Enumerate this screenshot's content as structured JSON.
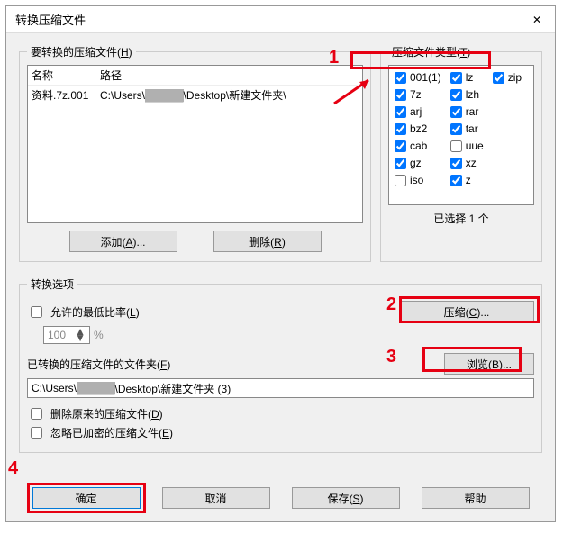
{
  "window": {
    "title": "转换压缩文件"
  },
  "source": {
    "group_label": "要转换的压缩文件(",
    "group_hotkey": "H",
    "group_label_end": ")",
    "col_name": "名称",
    "col_path": "路径",
    "rows": [
      {
        "name": "资料.7z.001",
        "path_pre": "C:\\Users\\",
        "path_mask": "█████",
        "path_post": "\\Desktop\\新建文件夹\\"
      }
    ],
    "add_btn": "添加(",
    "add_hotkey": "A",
    "add_end": ")...",
    "remove_btn": "删除(",
    "remove_hotkey": "R",
    "remove_end": ")"
  },
  "types": {
    "group_label": "压缩文件类型(",
    "group_hotkey": "T",
    "group_end": ")",
    "items": [
      {
        "label": "001(1)",
        "checked": true
      },
      {
        "label": "7z",
        "checked": true
      },
      {
        "label": "arj",
        "checked": true
      },
      {
        "label": "bz2",
        "checked": true
      },
      {
        "label": "cab",
        "checked": true
      },
      {
        "label": "gz",
        "checked": true
      },
      {
        "label": "iso",
        "checked": false
      },
      {
        "label": "lz",
        "checked": true
      },
      {
        "label": "lzh",
        "checked": true
      },
      {
        "label": "rar",
        "checked": true
      },
      {
        "label": "tar",
        "checked": true
      },
      {
        "label": "uue",
        "checked": false
      },
      {
        "label": "xz",
        "checked": true
      },
      {
        "label": "z",
        "checked": true
      },
      {
        "label": "zip",
        "checked": true
      }
    ],
    "selected_text": "已选择 1 个"
  },
  "options": {
    "group_label": "转换选项",
    "allow_min_ratio": "允许的最低比率(",
    "allow_min_hotkey": "L",
    "allow_min_end": ")",
    "ratio_value": "100",
    "ratio_unit": "%",
    "compress_btn": "压缩(",
    "compress_hotkey": "C",
    "compress_end": ")...",
    "folder_label": "已转换的压缩文件的文件夹(",
    "folder_hotkey": "F",
    "folder_end": ")",
    "folder_path_pre": "C:\\Users\\",
    "folder_path_mask": "█████",
    "folder_path_post": "\\Desktop\\新建文件夹 (3)",
    "browse_btn": "浏览(",
    "browse_hotkey": "B",
    "browse_end": ")...",
    "delete_orig": "删除原来的压缩文件(",
    "delete_hotkey": "D",
    "delete_end": ")",
    "ignore_enc": "忽略已加密的压缩文件(",
    "ignore_hotkey": "E",
    "ignore_end": ")"
  },
  "footer": {
    "ok": "确定",
    "cancel": "取消",
    "save": "保存(",
    "save_hotkey": "S",
    "save_end": ")",
    "help": "帮助"
  },
  "annotations": {
    "n1": "1",
    "n2": "2",
    "n3": "3",
    "n4": "4"
  }
}
